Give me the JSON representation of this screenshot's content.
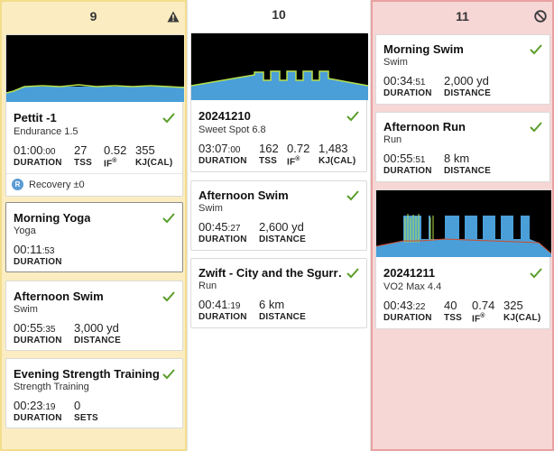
{
  "days": [
    {
      "date": "9",
      "status_icon": "warning-icon",
      "cards": [
        {
          "title": "Pettit -1",
          "subtitle": "Endurance 1.5",
          "duration": "01:00",
          "duration_sec": ":00",
          "tss": "27",
          "if": "0.52",
          "kj": "355"
        },
        {
          "recovery_badge": "R",
          "recovery": "Recovery ±0"
        },
        {
          "title": "Morning Yoga",
          "subtitle": "Yoga",
          "duration": "00:11",
          "duration_sec": ":53"
        },
        {
          "title": "Afternoon Swim",
          "subtitle": "Swim",
          "duration": "00:55",
          "duration_sec": ":35",
          "distance": "3,000 yd"
        },
        {
          "title": "Evening Strength Training",
          "subtitle": "Strength Training",
          "duration": "00:23",
          "duration_sec": ":19",
          "sets": "0"
        }
      ]
    },
    {
      "date": "10",
      "cards": [
        {
          "title": "20241210",
          "subtitle": "Sweet Spot 6.8",
          "duration": "03:07",
          "duration_sec": ":00",
          "tss": "162",
          "if": "0.72",
          "kj": "1,483"
        },
        {
          "title": "Afternoon Swim",
          "subtitle": "Swim",
          "duration": "00:45",
          "duration_sec": ":27",
          "distance": "2,600 yd"
        },
        {
          "title": "Zwift - City and the Sgurr…",
          "subtitle": "Run",
          "duration": "00:41",
          "duration_sec": ":19",
          "distance": "6 km"
        }
      ]
    },
    {
      "date": "11",
      "status_icon": "no-entry-icon",
      "cards": [
        {
          "title": "Morning Swim",
          "subtitle": "Swim",
          "duration": "00:34",
          "duration_sec": ":51",
          "distance": "2,000 yd"
        },
        {
          "title": "Afternoon Run",
          "subtitle": "Run",
          "duration": "00:55",
          "duration_sec": ":51",
          "distance": "8 km"
        },
        {
          "title": "20241211",
          "subtitle": "VO2 Max 4.4",
          "duration": "00:43",
          "duration_sec": ":22",
          "tss": "40",
          "if": "0.74",
          "kj": "325"
        }
      ]
    }
  ],
  "labels": {
    "duration": "DURATION",
    "tss": "TSS",
    "if": "IF",
    "if_mark": "®",
    "kj": "KJ(CAL)",
    "distance": "DISTANCE",
    "sets": "SETS"
  },
  "colors": {
    "check": "#5a9e2a",
    "graph_fill": "#4a9fd8",
    "graph_highlight": "#b7e04a",
    "warning": "#3a3a3a"
  }
}
